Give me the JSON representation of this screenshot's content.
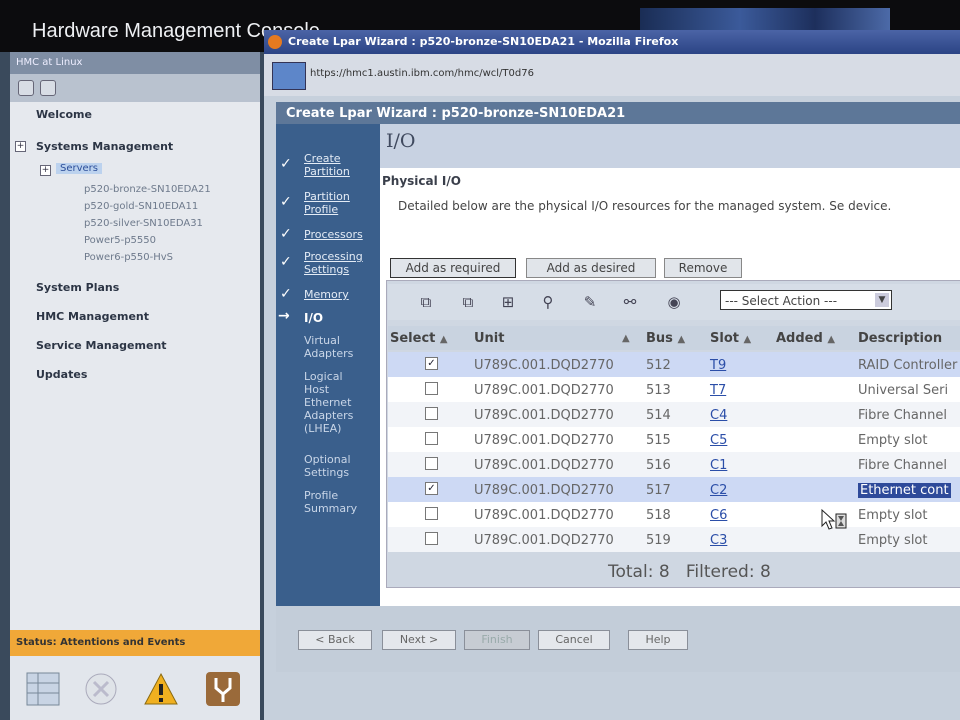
{
  "hmc": {
    "title": "Hardware Management Console",
    "nav_bar": "HMC at Linux",
    "nav": {
      "welcome": "Welcome",
      "systems_management": "Systems Management",
      "servers": "Servers",
      "servers_list": [
        "p520-bronze-SN10EDA21",
        "p520-gold-SN10EDA11",
        "p520-silver-SN10EDA31",
        "Power5-p5550",
        "Power6-p550-HvS"
      ],
      "system_plans": "System Plans",
      "hmc_management": "HMC Management",
      "service_management": "Service Management",
      "updates": "Updates"
    },
    "status_bar": "Status: Attentions and Events"
  },
  "browser": {
    "title": "Create Lpar Wizard : p520-bronze-SN10EDA21 - Mozilla Firefox",
    "url": "https://hmc1.austin.ibm.com/hmc/wcl/T0d76"
  },
  "wizard": {
    "title": "Create Lpar Wizard : p520-bronze-SN10EDA21",
    "page_title": "I/O",
    "steps": [
      {
        "label": "Create Partition",
        "state": "done"
      },
      {
        "label": "Partition Profile",
        "state": "done"
      },
      {
        "label": "Processors",
        "state": "done"
      },
      {
        "label": "Processing Settings",
        "state": "done"
      },
      {
        "label": "Memory",
        "state": "done"
      },
      {
        "label": "I/O",
        "state": "current"
      },
      {
        "label": "Virtual Adapters",
        "state": "todo"
      },
      {
        "label": "Logical Host Ethernet Adapters (LHEA)",
        "state": "todo"
      },
      {
        "label": "Optional Settings",
        "state": "todo"
      },
      {
        "label": "Profile Summary",
        "state": "todo"
      }
    ],
    "physical_io_label": "Physical I/O",
    "description": "Detailed below are the physical I/O resources for the managed system. Se device.",
    "buttons": {
      "add_required": "Add as required",
      "add_desired": "Add as desired",
      "remove": "Remove"
    },
    "select_action": "--- Select Action ---",
    "columns": {
      "select": "Select",
      "unit": "Unit",
      "bus": "Bus",
      "slot": "Slot",
      "added": "Added",
      "description": "Description"
    },
    "rows": [
      {
        "checked": true,
        "unit": "U789C.001.DQD2770",
        "bus": "512",
        "slot": "T9",
        "added": "",
        "description": "RAID Controller"
      },
      {
        "checked": false,
        "unit": "U789C.001.DQD2770",
        "bus": "513",
        "slot": "T7",
        "added": "",
        "description": "Universal Seri"
      },
      {
        "checked": false,
        "unit": "U789C.001.DQD2770",
        "bus": "514",
        "slot": "C4",
        "added": "",
        "description": "Fibre Channel"
      },
      {
        "checked": false,
        "unit": "U789C.001.DQD2770",
        "bus": "515",
        "slot": "C5",
        "added": "",
        "description": "Empty slot"
      },
      {
        "checked": false,
        "unit": "U789C.001.DQD2770",
        "bus": "516",
        "slot": "C1",
        "added": "",
        "description": "Fibre Channel"
      },
      {
        "checked": true,
        "unit": "U789C.001.DQD2770",
        "bus": "517",
        "slot": "C2",
        "added": "",
        "description": "Ethernet cont"
      },
      {
        "checked": false,
        "unit": "U789C.001.DQD2770",
        "bus": "518",
        "slot": "C6",
        "added": "",
        "description": "Empty slot"
      },
      {
        "checked": false,
        "unit": "U789C.001.DQD2770",
        "bus": "519",
        "slot": "C3",
        "added": "",
        "description": "Empty slot"
      }
    ],
    "total_text": "Total: 8",
    "filtered_text": "Filtered: 8",
    "nav_buttons": {
      "back": "< Back",
      "next": "Next >",
      "finish": "Finish",
      "cancel": "Cancel",
      "help": "Help"
    }
  }
}
